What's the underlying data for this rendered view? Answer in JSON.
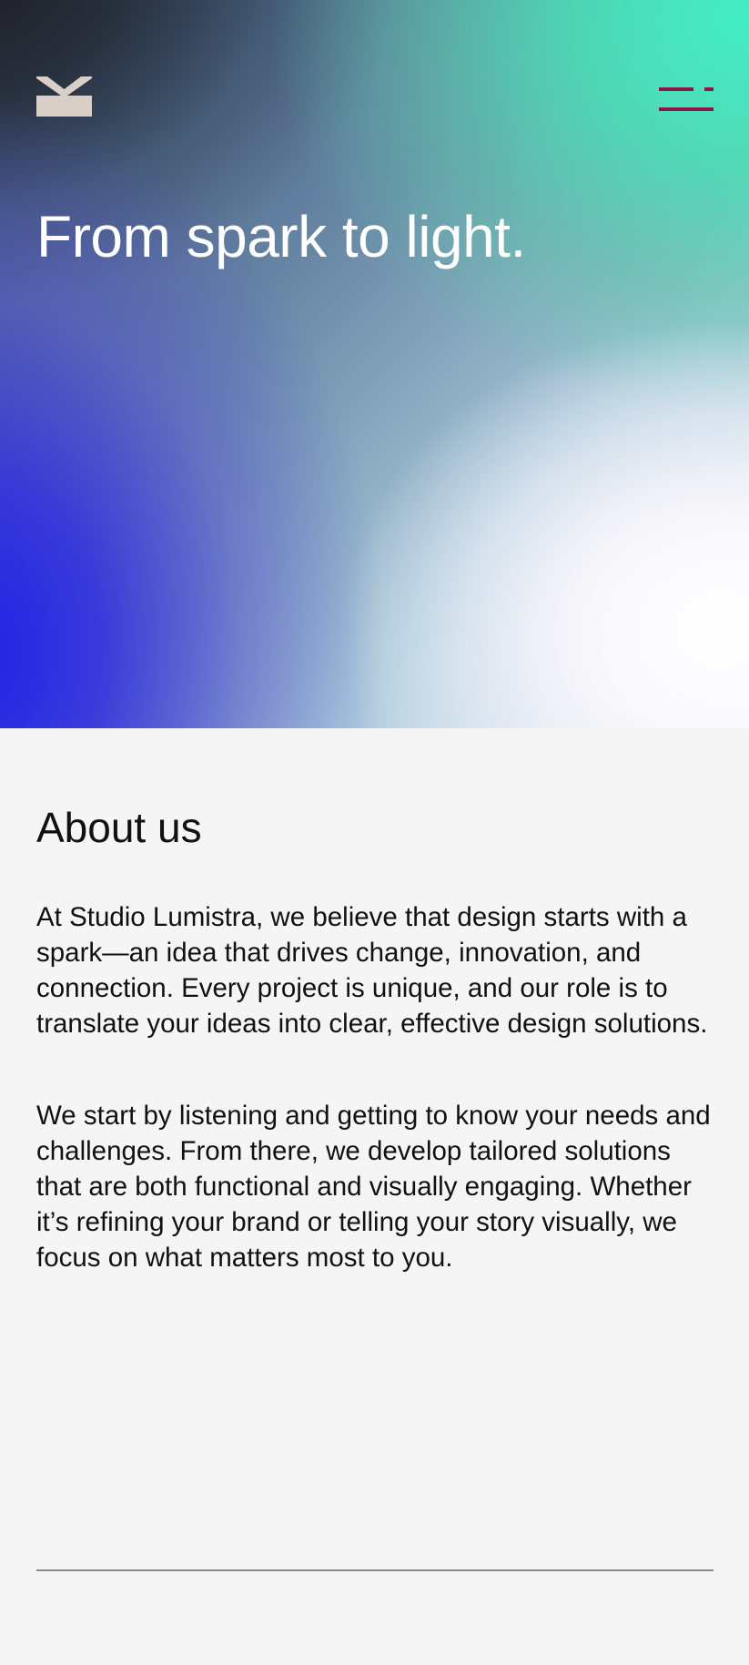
{
  "brand": {
    "logo_icon": "k-monogram-logo-icon",
    "logo_color": "#d8cfc6"
  },
  "header": {
    "menu_icon": "hamburger-menu-icon",
    "menu_color": "#8a1846"
  },
  "hero": {
    "title": "From spark to light.",
    "gradient_colors": [
      "#25242a",
      "#2424e3",
      "#45e8c4",
      "#ffffff"
    ]
  },
  "about": {
    "title": "About us",
    "paragraphs": [
      "At Studio Lumistra, we believe that design starts with a spark—an idea that drives change, innovation, and connection. Every project is unique, and our role is to translate your ideas into clear, effective design solutions.",
      "We start by listening and getting to know your needs and challenges. From there, we develop tailored solutions that are both functional and visually engaging. Whether it’s refining your brand or telling your story visually, we focus on what matters most to you."
    ]
  },
  "colors": {
    "page_background": "#f5f5f5",
    "text": "#111111",
    "divider": "#8c8c8c"
  }
}
